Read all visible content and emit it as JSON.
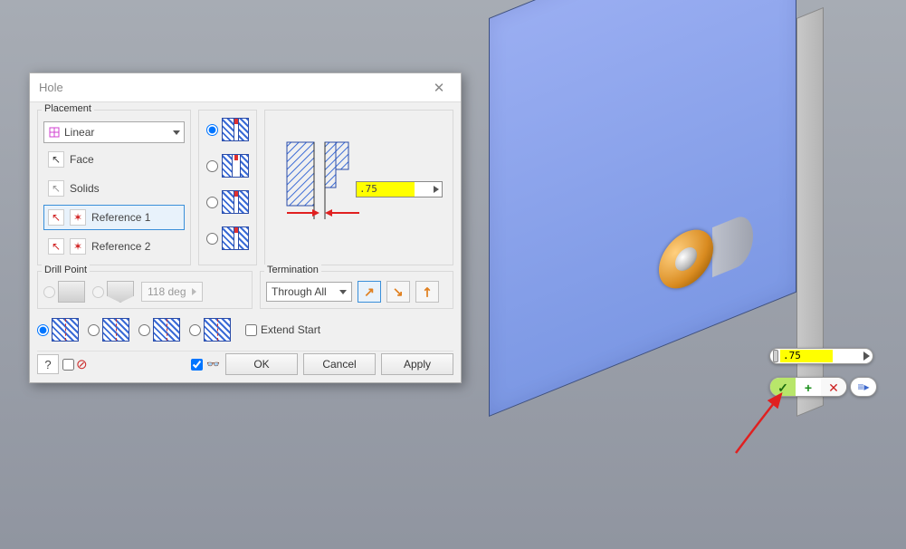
{
  "dialog": {
    "title": "Hole",
    "placement": {
      "legend": "Placement",
      "mode": "Linear",
      "face_label": "Face",
      "solids_label": "Solids",
      "ref1_label": "Reference 1",
      "ref2_label": "Reference 2"
    },
    "diameter_value": ".75",
    "drillpoint": {
      "legend": "Drill Point",
      "angle": "118 deg"
    },
    "termination": {
      "legend": "Termination",
      "mode": "Through All"
    },
    "extend_start_label": "Extend Start",
    "buttons": {
      "ok": "OK",
      "cancel": "Cancel",
      "apply": "Apply"
    }
  },
  "viewport": {
    "float_value": ".75"
  },
  "icons": {
    "close": "✕",
    "cursor": "↖",
    "star": "✶",
    "help": "?",
    "forbid": "⊘",
    "glasses": "👓",
    "ne_arrow": "↗",
    "accept": "✓",
    "plus": "+",
    "cancel_x": "✕",
    "more": "≡▸"
  }
}
